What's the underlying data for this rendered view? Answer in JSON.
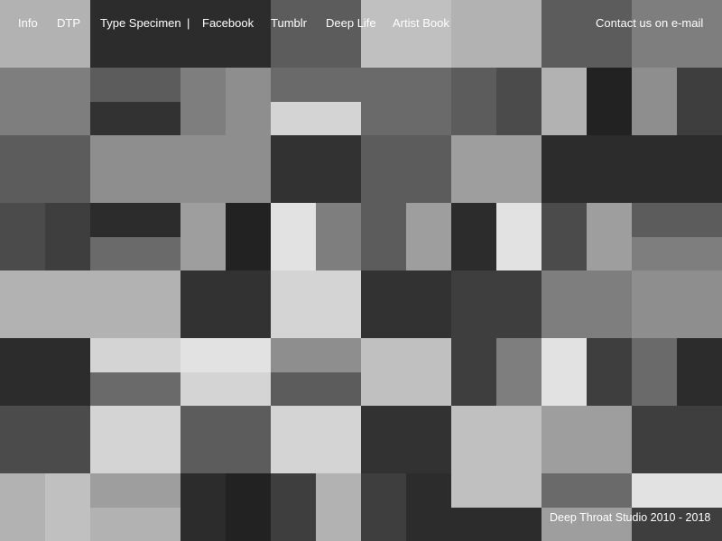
{
  "nav": {
    "items": [
      "Info",
      "DTP",
      "Type Specimen",
      "Facebook",
      "Tumblr",
      "Deep Life",
      "Artist Book"
    ],
    "separator": "|",
    "contact": "Contact us on e-mail"
  },
  "footer": {
    "credit": "Deep Throat Studio 2010 - 2018"
  },
  "colors": {
    "text": "#ffffff",
    "palette": [
      "#222222",
      "#2c2c2c",
      "#323232",
      "#3e3e3e",
      "#4b4b4b",
      "#5c5c5c",
      "#6a6a6a",
      "#7e7e7e",
      "#8e8e8e",
      "#9e9e9e",
      "#b2b2b2",
      "#c0c0c0",
      "#d4d4d4",
      "#e2e2e2"
    ]
  }
}
